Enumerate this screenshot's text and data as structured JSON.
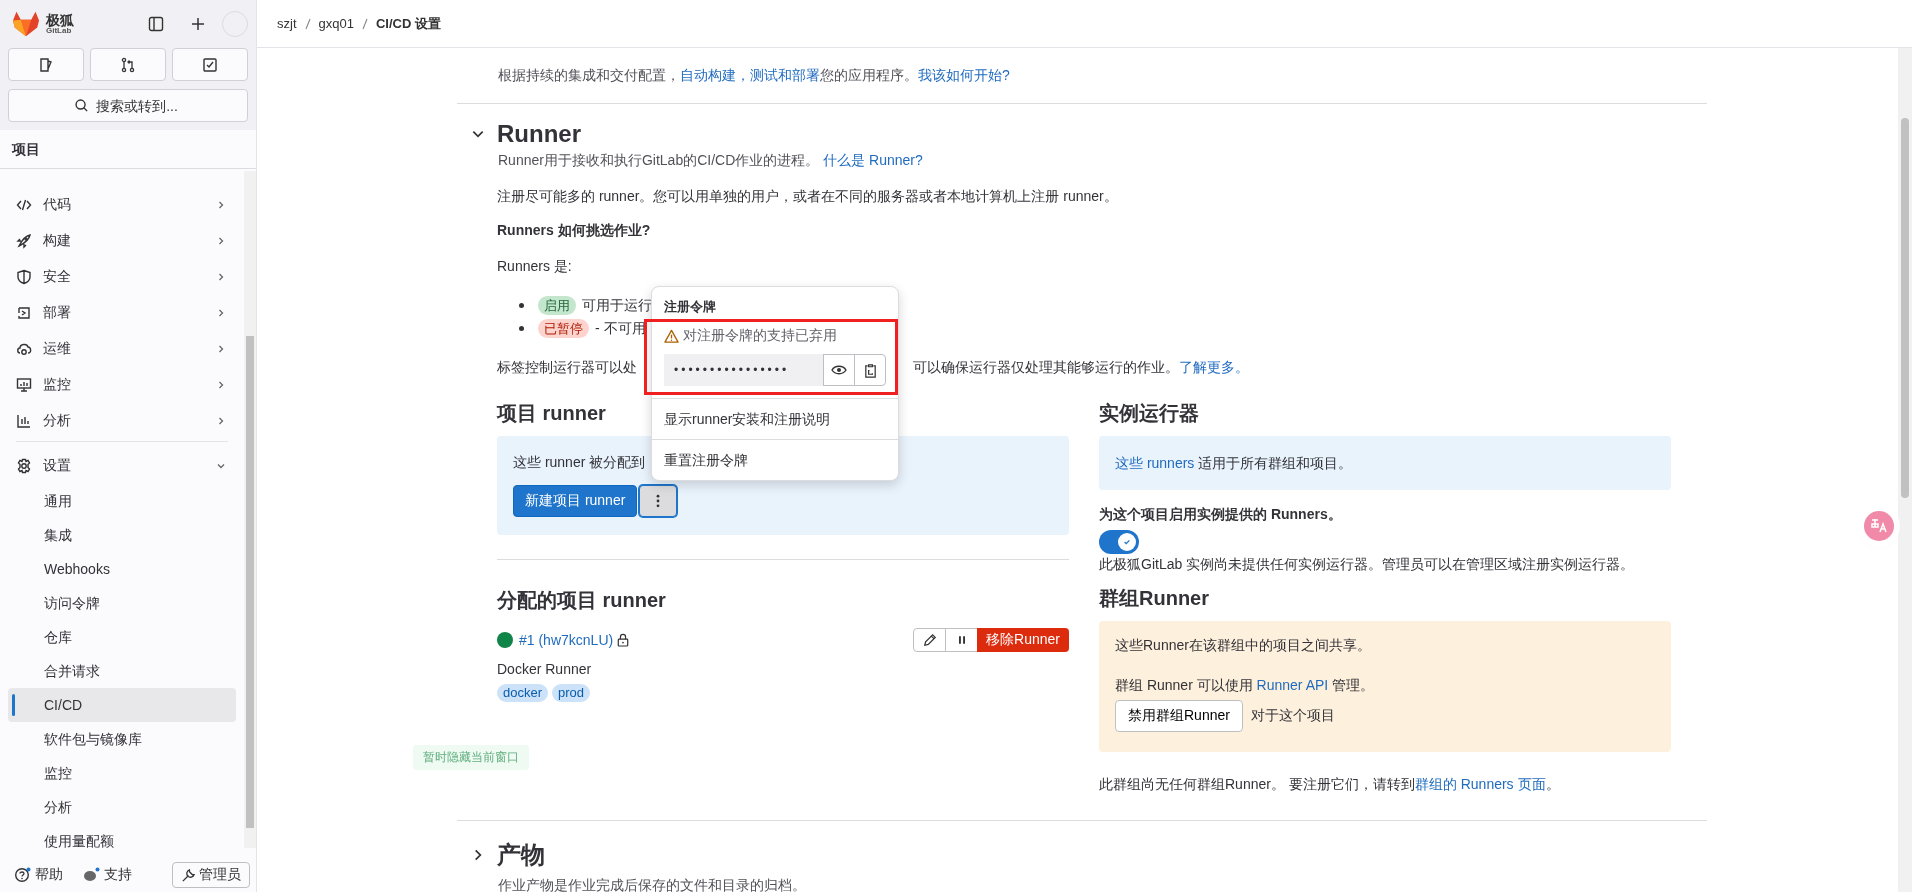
{
  "sidebar": {
    "brand": "极狐",
    "brand_sub": "GitLab",
    "search": {
      "placeholder": "搜索或转到..."
    },
    "section_title": "项目",
    "items": [
      {
        "label": "代码",
        "expanded": false
      },
      {
        "label": "构建",
        "expanded": false
      },
      {
        "label": "安全",
        "expanded": false
      },
      {
        "label": "部署",
        "expanded": false
      },
      {
        "label": "运维",
        "expanded": false
      },
      {
        "label": "监控",
        "expanded": false
      },
      {
        "label": "分析",
        "expanded": false
      },
      {
        "label": "设置",
        "expanded": true,
        "children": [
          {
            "label": "通用",
            "selected": false
          },
          {
            "label": "集成",
            "selected": false
          },
          {
            "label": "Webhooks",
            "selected": false
          },
          {
            "label": "访问令牌",
            "selected": false
          },
          {
            "label": "仓库",
            "selected": false
          },
          {
            "label": "合并请求",
            "selected": false
          },
          {
            "label": "CI/CD",
            "selected": true
          },
          {
            "label": "软件包与镜像库",
            "selected": false
          },
          {
            "label": "监控",
            "selected": false
          },
          {
            "label": "分析",
            "selected": false
          },
          {
            "label": "使用量配额",
            "selected": false
          }
        ]
      }
    ],
    "footer": [
      {
        "label": "帮助",
        "kind": "help"
      },
      {
        "label": "支持",
        "kind": "support"
      },
      {
        "label": "管理员",
        "kind": "admin"
      }
    ]
  },
  "breadcrumbs": [
    "szjt",
    "gxq01",
    "CI/CD 设置"
  ],
  "auto_devops": {
    "description": [
      {
        "text": "根据持续的集成和交付配置，"
      },
      {
        "text": "自动构建，测试和部署",
        "link": true
      },
      {
        "text": "您的应用程序。"
      },
      {
        "text": "我该如何开始?",
        "link": true
      }
    ]
  },
  "runner_section": {
    "title": "Runner",
    "expanded": true,
    "description": [
      {
        "text": "Runner用于接收和执行GitLab的CI/CD作业的进程。 "
      },
      {
        "text": "什么是 Runner?",
        "link": true
      }
    ],
    "intro": "注册尽可能多的 runner。您可以用单独的用户，或者在不同的服务器或者本地计算机上注册 runner。",
    "question": "Runners 如何挑选作业?",
    "runners_label": "Runners 是:",
    "status_list": [
      {
        "badge": "启用",
        "kind": "active",
        "text": "可用于运行"
      },
      {
        "badge": "已暂停",
        "kind": "paused",
        "text": "- 不可用"
      }
    ],
    "tags_paragraph": {
      "before": "标签控制运行器可以处",
      "after": [
        {
          "text": "可以确保运行器仅处理其能够运行的作业。"
        },
        {
          "text": "了解更多。",
          "link": true
        }
      ]
    }
  },
  "project_runners": {
    "title": "项目 runner",
    "info": "这些 runner 被分配到",
    "new_button": "新建项目 runner",
    "menu_open": true
  },
  "dropdown": {
    "title": "注册令牌",
    "warning": "对注册令牌的支持已弃用",
    "token": "••••••••••••••••",
    "items": [
      "显示runner安装和注册说明",
      "重置注册令牌"
    ],
    "highlighted": true
  },
  "assigned_runners": {
    "title": "分配的项目 runner",
    "runners": [
      {
        "color": "#108548",
        "name": "#1 (hw7kcnLU)",
        "locked": true,
        "description": "Docker Runner",
        "tags": [
          "docker",
          "prod"
        ],
        "remove_label": "移除Runner"
      }
    ]
  },
  "instance_runners": {
    "title": "实例运行器",
    "info": [
      {
        "text": "这些 runners",
        "link": true
      },
      {
        "text": " 适用于所有群组和项目。"
      }
    ],
    "toggle_label": "为这个项目启用实例提供的 Runners。",
    "toggle_on": true,
    "note": "此极狐GitLab 实例尚未提供任何实例运行器。管理员可以在管理区域注册实例运行器。"
  },
  "group_runners": {
    "title": "群组Runner",
    "shared_text": "这些Runner在该群组中的项目之间共享。",
    "api_text": [
      {
        "text": "群组 Runner 可以使用 "
      },
      {
        "text": "Runner API",
        "link": true
      },
      {
        "text": " 管理。"
      }
    ],
    "disable_button": "禁用群组Runner",
    "button_note": "对于这个项目",
    "footer": [
      {
        "text": "此群组尚无任何群组Runner。 要注册它们，请转到"
      },
      {
        "text": "群组的 Runners 页面",
        "link": true
      },
      {
        "text": "。"
      }
    ]
  },
  "artifacts": {
    "title": "产物",
    "expanded": false,
    "description": "作业产物是作业完成后保存的文件和目录的归档。"
  },
  "toast": "暂时隐藏当前窗口"
}
